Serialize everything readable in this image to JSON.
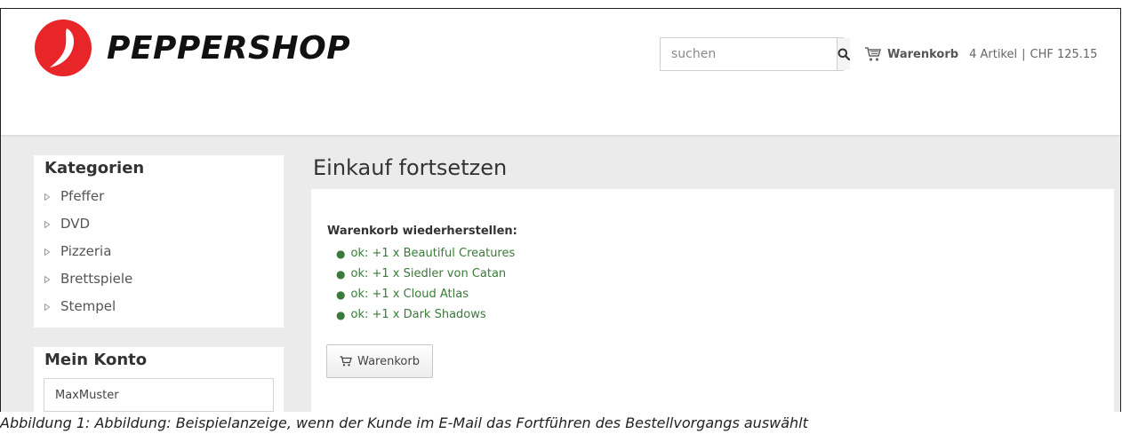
{
  "brand": {
    "name": "PEPPERSHOP",
    "color": "#e8262a"
  },
  "header": {
    "search": {
      "placeholder": "suchen"
    },
    "cart": {
      "label": "Warenkorb",
      "items": "4 Artikel",
      "separator": "|",
      "total": "CHF 125.15"
    }
  },
  "sidebar": {
    "categories": {
      "title": "Kategorien",
      "items": [
        {
          "label": "Pfeffer"
        },
        {
          "label": "DVD"
        },
        {
          "label": "Pizzeria"
        },
        {
          "label": "Brettspiele"
        },
        {
          "label": "Stempel"
        }
      ]
    },
    "account": {
      "title": "Mein Konto",
      "username": "MaxMuster"
    }
  },
  "main": {
    "title": "Einkauf fortsetzen",
    "restore_heading": "Warenkorb wiederherstellen:",
    "restore_items": [
      "ok: +1 x Beautiful Creatures",
      "ok: +1 x Siedler von Catan",
      "ok: +1 x Cloud Atlas",
      "ok: +1 x Dark Shadows"
    ],
    "cart_button_label": "Warenkorb",
    "success_color": "#3a7a3a"
  },
  "caption": "Abbildung 1: Abbildung: Beispielanzeige, wenn der Kunde im E-Mail das Fortführen des Bestellvorgangs auswählt"
}
